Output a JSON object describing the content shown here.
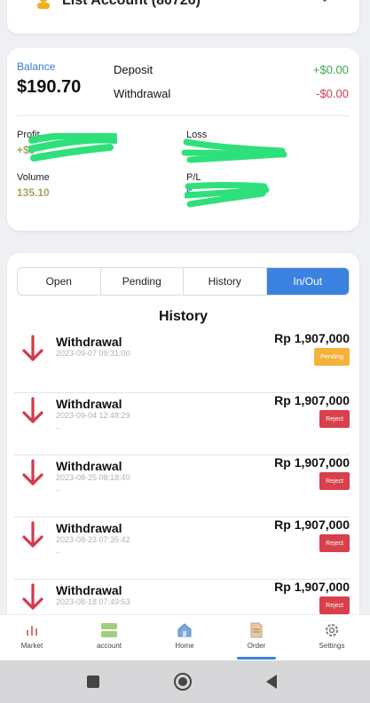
{
  "account": {
    "title": "List Account (80726)"
  },
  "balance_card": {
    "balance_label": "Balance",
    "balance_value": "$190.70",
    "deposit_label": "Deposit",
    "deposit_value": "+$0.00",
    "withdrawal_label": "Withdrawal",
    "withdrawal_value": "-$0.00",
    "profit_label": "Profit",
    "profit_value": "+$5",
    "loss_label": "Loss",
    "volume_label": "Volume",
    "volume_value": "135.10",
    "pl_label": "P/L",
    "pl_value": "$-",
    "colors": {
      "accent": "#3a7bd5",
      "positive": "#3aa64a",
      "negative": "#d23b48",
      "volume": "#a8a35a"
    }
  },
  "tabs": [
    "Open",
    "Pending",
    "History",
    "In/Out"
  ],
  "active_tab": "In/Out",
  "history_title": "History",
  "transactions": [
    {
      "type": "Withdrawal",
      "datetime": "2023-09-07 09:31:00",
      "amount": "Rp 1,907,000",
      "status": "Pending",
      "status_color": "#f4b23a"
    },
    {
      "type": "Withdrawal",
      "datetime": "2023-09-04 12:48:29",
      "amount": "Rp 1,907,000",
      "status": "Reject",
      "status_color": "#d8404b"
    },
    {
      "type": "Withdrawal",
      "datetime": "2023-08-25 08:18:40",
      "amount": "Rp 1,907,000",
      "status": "Reject",
      "status_color": "#d8404b"
    },
    {
      "type": "Withdrawal",
      "datetime": "2023-08-23 07:35:42",
      "amount": "Rp 1,907,000",
      "status": "Reject",
      "status_color": "#d8404b"
    },
    {
      "type": "Withdrawal",
      "datetime": "2023-08-18 07:49:53",
      "amount": "Rp 1,907,000",
      "status": "Reject",
      "status_color": "#d8404b"
    }
  ],
  "bottom_nav": [
    {
      "label": "Market",
      "icon": "chart-icon"
    },
    {
      "label": "account",
      "icon": "account-cards-icon"
    },
    {
      "label": "Home",
      "icon": "home-icon"
    },
    {
      "label": "Order",
      "icon": "order-doc-icon"
    },
    {
      "label": "Settings",
      "icon": "gear-icon"
    }
  ],
  "active_nav": "Order"
}
